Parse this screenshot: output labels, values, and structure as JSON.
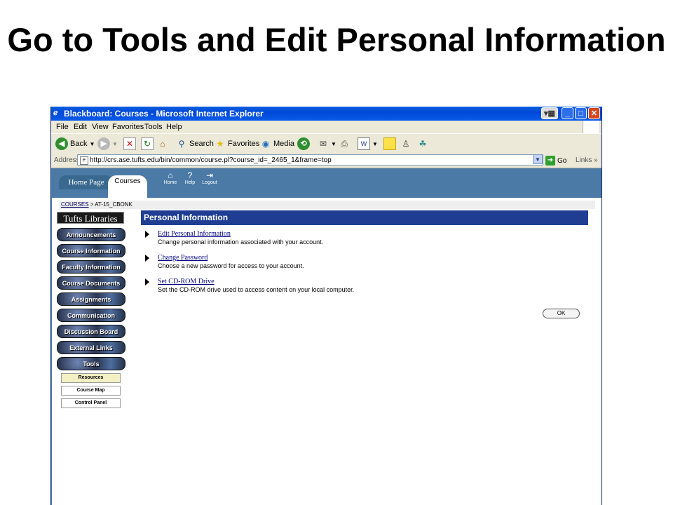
{
  "slide": {
    "title": "Go to Tools and Edit Personal Information"
  },
  "browser": {
    "window_title": "Blackboard: Courses - Microsoft Internet Explorer",
    "menu": [
      "File",
      "Edit",
      "View",
      "Favorites",
      "Tools",
      "Help"
    ],
    "toolbar": {
      "back": "Back",
      "search": "Search",
      "favorites": "Favorites",
      "media": "Media"
    },
    "address": {
      "label": "Address",
      "url": "http://crs.ase.tufts.edu/bin/common/course.pl?course_id=_2465_1&frame=top",
      "go": "Go",
      "links": "Links"
    }
  },
  "blackboard": {
    "tabs": [
      "Home Page",
      "Courses"
    ],
    "header_icons": [
      {
        "icon": "home-icon",
        "label": "Home"
      },
      {
        "icon": "help-icon",
        "label": "Help"
      },
      {
        "icon": "logout-icon",
        "label": "Logout"
      }
    ],
    "breadcrumb": {
      "link": "COURSES",
      "rest": " > AT-15_CBONK"
    },
    "library_logo": "Tufts Libraries",
    "nav_buttons": [
      "Announcements",
      "Course Information",
      "Faculty Information",
      "Course Documents",
      "Assignments",
      "Communication",
      "Discussion Board",
      "External Links",
      "Tools"
    ],
    "sub_buttons": [
      "Resources",
      "Course Map",
      "Control Panel"
    ],
    "panel_title": "Personal Information",
    "options": [
      {
        "title": "Edit Personal Information",
        "desc": "Change personal information associated with your account."
      },
      {
        "title": "Change Password",
        "desc": "Choose a new password for access to your account."
      },
      {
        "title": "Set CD-ROM Drive",
        "desc": "Set the CD-ROM drive used to access content on your local computer."
      }
    ],
    "ok_label": "OK"
  },
  "colors": {
    "panel_header": "#1f3e93",
    "blackboard_header": "#4a7aa5",
    "xp_titlebar": "#0048d8"
  }
}
